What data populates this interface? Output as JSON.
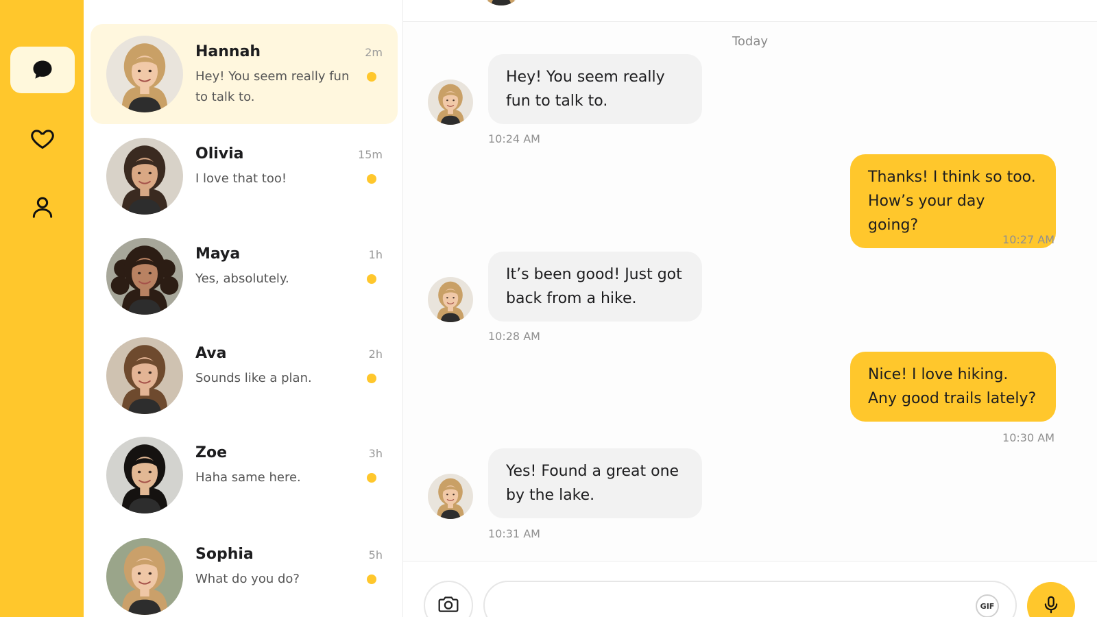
{
  "colors": {
    "accent": "#FFC72C",
    "active_row": "#FFF7DE",
    "incoming_bubble": "#F2F2F2",
    "unread_dot": "#FFC72C"
  },
  "rail": {
    "items": [
      {
        "icon": "chat-bubble-icon",
        "active": true
      },
      {
        "icon": "heart-icon",
        "active": false
      },
      {
        "icon": "user-icon",
        "active": false
      }
    ]
  },
  "conversations": [
    {
      "name": "Hannah",
      "time": "2m",
      "preview": "Hey! You seem really fun to talk to.",
      "unread": true,
      "active": true,
      "avatar": "hannah"
    },
    {
      "name": "Olivia",
      "time": "15m",
      "preview": "I love that too!",
      "unread": true,
      "active": false,
      "avatar": "olivia"
    },
    {
      "name": "Maya",
      "time": "1h",
      "preview": "Yes, absolutely.",
      "unread": true,
      "active": false,
      "avatar": "maya"
    },
    {
      "name": "Ava",
      "time": "2h",
      "preview": "Sounds like a plan.",
      "unread": true,
      "active": false,
      "avatar": "ava"
    },
    {
      "name": "Zoe",
      "time": "3h",
      "preview": "Haha same here.",
      "unread": true,
      "active": false,
      "avatar": "zoe"
    },
    {
      "name": "Sophia",
      "time": "5h",
      "preview": "What do you do?",
      "unread": true,
      "active": false,
      "avatar": "sophia"
    }
  ],
  "chat": {
    "day_label": "Today",
    "messages": [
      {
        "direction": "in",
        "text": "Hey! You seem really fun to talk to.",
        "time": "10:24 AM"
      },
      {
        "direction": "out",
        "text": "Thanks! I think so too. How’s your day going?",
        "time": "10:27 AM"
      },
      {
        "direction": "in",
        "text": "It’s been good! Just got back from a hike.",
        "time": "10:28 AM"
      },
      {
        "direction": "out",
        "text": "Nice! I love hiking. Any good trails lately?",
        "time": "10:30 AM"
      },
      {
        "direction": "in",
        "text": "Yes! Found a great one by the lake.",
        "time": "10:31 AM"
      }
    ]
  },
  "composer": {
    "placeholder": "",
    "value": "",
    "gif_label": "GIF",
    "camera_icon": "camera-icon",
    "mic_icon": "microphone-icon"
  }
}
